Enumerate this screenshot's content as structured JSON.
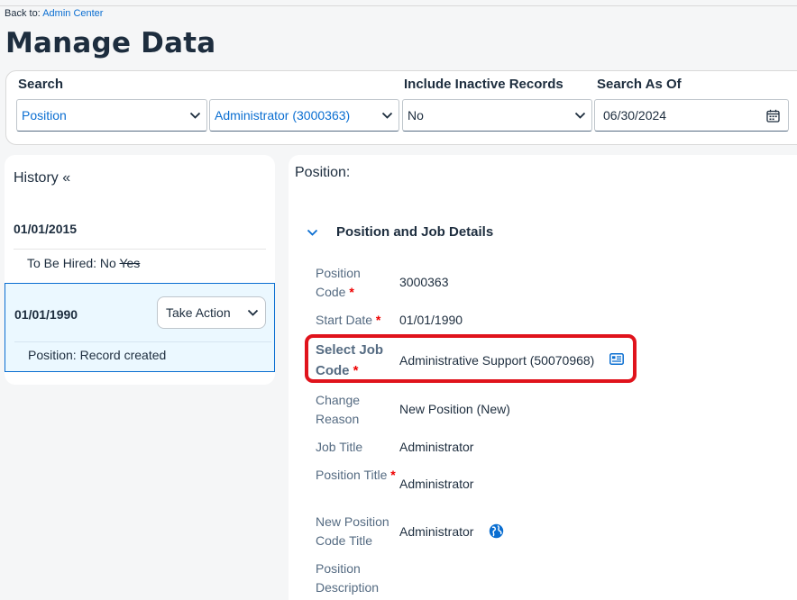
{
  "header": {
    "back_prefix": "Back to:",
    "back_link": "Admin Center",
    "title": "Manage Data"
  },
  "search": {
    "label_search": "Search",
    "type_value": "Position",
    "record_value": "Administrator (3000363)",
    "label_inactive": "Include Inactive Records",
    "inactive_value": "No",
    "label_asof": "Search As Of",
    "asof_value": "06/30/2024"
  },
  "history": {
    "title": "History «",
    "entries": [
      {
        "date": "01/01/2015",
        "change_label": "To Be Hired: No ",
        "change_old": "Yes"
      },
      {
        "date": "01/01/1990",
        "action_label": "Take Action",
        "change_label": "Position: Record created"
      }
    ]
  },
  "detail": {
    "heading": "Position:",
    "section_title": "Position and Job Details",
    "fields": {
      "position_code": {
        "label": "Position Code",
        "value": "3000363"
      },
      "start_date": {
        "label": "Start Date",
        "value": "01/01/1990"
      },
      "job_code": {
        "label": "Select Job Code",
        "value": "Administrative Support (50070968)"
      },
      "change_reason": {
        "label": "Change Reason",
        "value": "New Position (New)"
      },
      "job_title": {
        "label": "Job Title",
        "value": "Administrator"
      },
      "position_title": {
        "label": "Position Title",
        "value": "Administrator"
      },
      "new_position_code_title": {
        "label": "New Position Code Title",
        "value": "Administrator"
      },
      "position_description": {
        "label": "Position Description",
        "value": ""
      }
    },
    "required_marker": "*"
  },
  "icons": {
    "chevron": "chevron-down-icon",
    "calendar": "calendar-icon",
    "card": "business-card-icon",
    "globe": "globe-icon"
  },
  "colors": {
    "link": "#0a6ed1",
    "required": "#e00000",
    "highlight": "#e0131c"
  }
}
